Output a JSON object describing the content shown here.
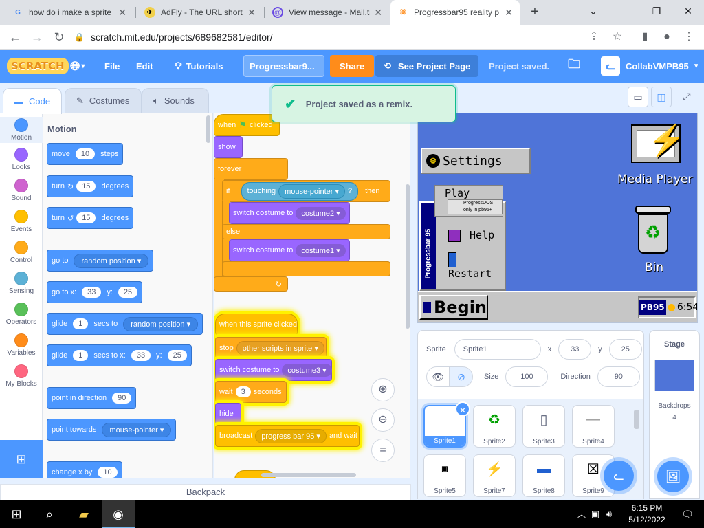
{
  "browser": {
    "tabs": [
      {
        "title": "how do i make a sprite",
        "favicon": "google-g"
      },
      {
        "title": "AdFly - The URL shorte",
        "favicon": "adfly-bee"
      },
      {
        "title": "View message - Mail.tm",
        "favicon": "mail-icon"
      },
      {
        "title": "Progressbar95 reality p",
        "favicon": "scratch-cat"
      }
    ],
    "url": "scratch.mit.edu/projects/689682581/editor/"
  },
  "menubar": {
    "logo": "SCRATCH",
    "file": "File",
    "edit": "Edit",
    "tutorials": "Tutorials",
    "project_title": "Progressbar9...",
    "share": "Share",
    "see_project": "See Project Page",
    "saved_status": "Project saved.",
    "username": "CollabVMPB95"
  },
  "toast": {
    "message": "Project saved as a remix."
  },
  "editor_tabs": {
    "code": "Code",
    "costumes": "Costumes",
    "sounds": "Sounds"
  },
  "categories": [
    {
      "label": "Motion",
      "color": "#4c97ff"
    },
    {
      "label": "Looks",
      "color": "#9966ff"
    },
    {
      "label": "Sound",
      "color": "#cf63cf"
    },
    {
      "label": "Events",
      "color": "#ffbf00"
    },
    {
      "label": "Control",
      "color": "#ffab19"
    },
    {
      "label": "Sensing",
      "color": "#5cb1d6"
    },
    {
      "label": "Operators",
      "color": "#59c059"
    },
    {
      "label": "Variables",
      "color": "#ff8c1a"
    },
    {
      "label": "My Blocks",
      "color": "#ff6680"
    }
  ],
  "palette": {
    "heading": "Motion",
    "move": {
      "a": "move",
      "v": "10",
      "b": "steps"
    },
    "turn_cw": {
      "a": "turn",
      "v": "15",
      "b": "degrees"
    },
    "turn_ccw": {
      "a": "turn",
      "v": "15",
      "b": "degrees"
    },
    "goto": {
      "a": "go to",
      "d": "random position"
    },
    "gotoxy": {
      "a": "go to x:",
      "x": "33",
      "y_label": "y:",
      "y": "25"
    },
    "glide_to": {
      "a": "glide",
      "v": "1",
      "b": "secs to",
      "d": "random position"
    },
    "glide_xy": {
      "a": "glide",
      "v": "1",
      "b": "secs to x:",
      "x": "33",
      "y_label": "y:",
      "y": "25"
    },
    "point_dir": {
      "a": "point in direction",
      "v": "90"
    },
    "point_towards": {
      "a": "point towards",
      "d": "mouse-pointer"
    },
    "change_x": {
      "a": "change x by",
      "v": "10"
    }
  },
  "script1": {
    "when_flag_a": "when",
    "when_flag_b": "clicked",
    "show": "show",
    "forever": "forever",
    "if": "if",
    "touching": "touching",
    "touching_target": "mouse-pointer",
    "q": "?",
    "then": "then",
    "switch1": "switch costume to",
    "costume2": "costume2",
    "else": "else",
    "switch2": "switch costume to",
    "costume1": "costume1"
  },
  "script2": {
    "hat": "when this sprite clicked",
    "stop": "stop",
    "stop_opt": "other scripts in sprite",
    "switch": "switch costume to",
    "costume3": "costume3",
    "wait": "wait",
    "wait_v": "3",
    "seconds": "seconds",
    "hide": "hide",
    "broadcast": "broadcast",
    "broadcast_msg": "progress bar 95",
    "and_wait": "and wait"
  },
  "backpack": "Backpack",
  "stage": {
    "settings": "Settings",
    "media_player": "Media Player",
    "bin": "Bin",
    "play": "Play",
    "progressdos": "ProgressDOS",
    "only_pb95": "only in pb95+",
    "help": "Help",
    "restart": "Restart",
    "side_label": "Progressbar 95",
    "begin": "Begin",
    "pb95": "PB95",
    "clock": "6:54"
  },
  "sprite_info": {
    "sprite_label": "Sprite",
    "sprite_name": "Sprite1",
    "x_label": "x",
    "x": "33",
    "y_label": "y",
    "y": "25",
    "show_label": "Show",
    "size_label": "Size",
    "size": "100",
    "direction_label": "Direction",
    "direction": "90"
  },
  "sprites": [
    "Sprite1",
    "Sprite2",
    "Sprite3",
    "Sprite4",
    "Sprite5",
    "Sprite7",
    "Sprite8",
    "Sprite9"
  ],
  "stage_pane": {
    "title": "Stage",
    "backdrops_label": "Backdrops",
    "backdrops_count": "4"
  },
  "taskbar": {
    "time": "6:15 PM",
    "date": "5/12/2022"
  }
}
